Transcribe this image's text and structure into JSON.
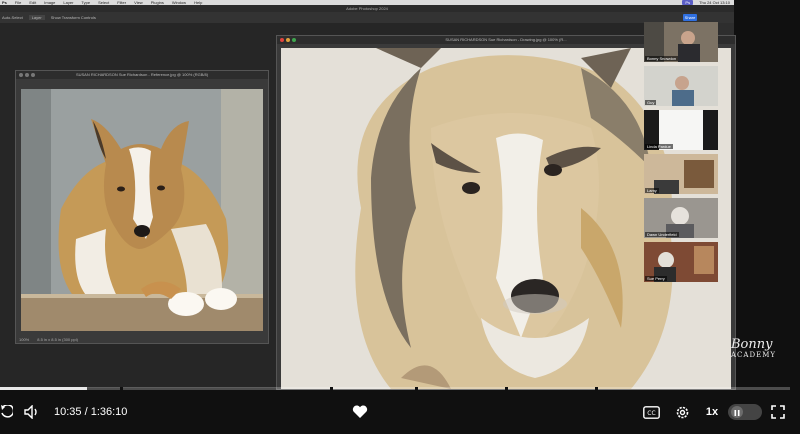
{
  "mac_menubar": {
    "items": [
      "Ps",
      "File",
      "Edit",
      "Image",
      "Layer",
      "Type",
      "Select",
      "Filter",
      "View",
      "Plugins",
      "Window",
      "Help"
    ],
    "badge": "Ps",
    "clock": "Thu 24 Oct 13:10"
  },
  "photoshop": {
    "app_title": "Adobe Photoshop 2024",
    "options": [
      "Auto-Select",
      "Layer",
      "Show Transform Controls"
    ],
    "share_label": "Share",
    "reference_window": {
      "title": "SUSAN RICHARDSON Sue Richardson - Reference.jpg @ 100% (RGB/8)",
      "zoom": "100%",
      "doc_size": "8.5 in x 8.5 in (300 ppi)"
    },
    "drawing_window": {
      "title": "SUSAN RICHARDSON Sue Richardson - Drawing.jpg @ 100% (R..."
    }
  },
  "participants": [
    {
      "name": "Bonny Snowdon"
    },
    {
      "name": "Guy"
    },
    {
      "name": "Linda Pardue"
    },
    {
      "name": "Lamy"
    },
    {
      "name": "Dawn Underfield"
    },
    {
      "name": "Sue Perry"
    }
  ],
  "watermark": {
    "line1": "Bonny",
    "line2": "ACADEMY"
  },
  "player": {
    "current_time": "10:35",
    "separator": " / ",
    "duration": "1:36:10",
    "progress_fraction": 0.11,
    "speed": "1x",
    "icons": [
      "replay-icon",
      "volume-icon",
      "heart-icon",
      "captions-icon",
      "settings-icon",
      "pause-icon",
      "fullscreen-icon"
    ]
  },
  "colors": {
    "accent": "#5b5fc7",
    "share": "#2f6fe0"
  }
}
